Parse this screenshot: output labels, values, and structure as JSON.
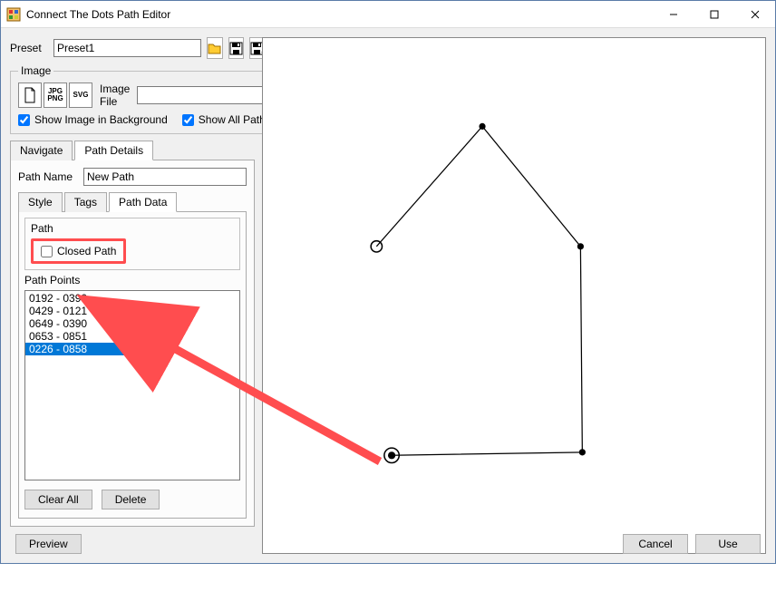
{
  "window": {
    "title": "Connect The Dots Path Editor"
  },
  "preset": {
    "label": "Preset",
    "value": "Preset1"
  },
  "icons": {
    "open": "open-folder-icon",
    "save": "save-icon",
    "save_plus": "save-plus-icon"
  },
  "image_group": {
    "legend": "Image",
    "filetypes": [
      "JPG\nPNG",
      "SVG"
    ],
    "file_label": "Image File",
    "file_value": "",
    "show_bg": {
      "label": "Show Image in Background",
      "checked": true
    },
    "show_all": {
      "label": "Show All Paths",
      "checked": true
    }
  },
  "main_tabs": [
    {
      "label": "Navigate",
      "active": false
    },
    {
      "label": "Path Details",
      "active": true
    }
  ],
  "path_name": {
    "label": "Path Name",
    "value": "New Path"
  },
  "sub_tabs": [
    {
      "label": "Style",
      "active": false
    },
    {
      "label": "Tags",
      "active": false
    },
    {
      "label": "Path Data",
      "active": true
    }
  ],
  "path_group": {
    "legend": "Path",
    "closed": {
      "label": "Closed Path",
      "checked": false
    }
  },
  "points": {
    "legend": "Path Points",
    "items": [
      "0192 - 0390",
      "0429 - 0121",
      "0649 - 0390",
      "0653 - 0851",
      "0226 - 0858"
    ],
    "selected_index": 4
  },
  "buttons": {
    "clear_all": "Clear All",
    "delete": "Delete",
    "preview": "Preview",
    "cancel": "Cancel",
    "use": "Use"
  },
  "chart_data": {
    "type": "line",
    "title": "",
    "xlabel": "",
    "ylabel": "",
    "closed": false,
    "coord_range": {
      "x": [
        0,
        1000
      ],
      "y": [
        0,
        1000
      ]
    },
    "series": [
      {
        "name": "New Path",
        "points_xy": [
          [
            192,
            390
          ],
          [
            429,
            121
          ],
          [
            649,
            390
          ],
          [
            653,
            851
          ],
          [
            226,
            858
          ]
        ]
      }
    ],
    "start_point_index": 0,
    "current_point_index": 4
  }
}
